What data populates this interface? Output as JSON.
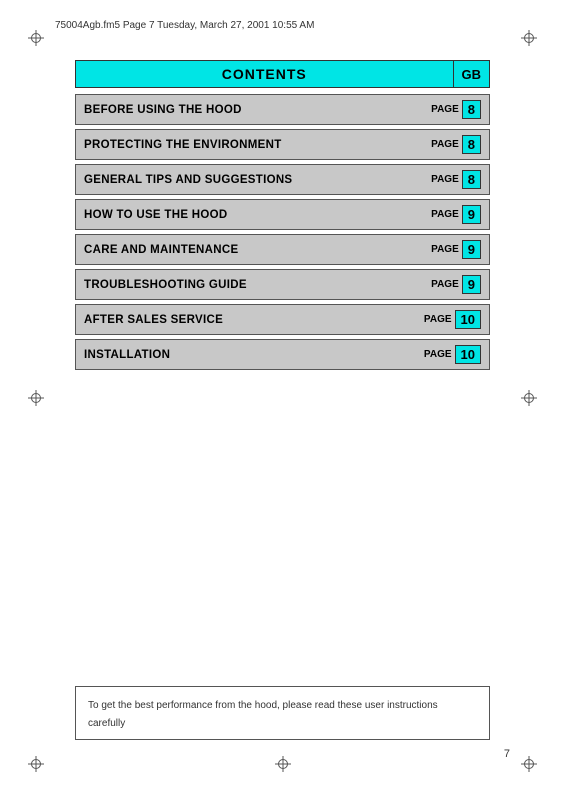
{
  "header": {
    "filename": "75004Agb.fm5  Page 7  Tuesday, March 27, 2001  10:55 AM"
  },
  "contents": {
    "title": "CONTENTS",
    "gb_label": "GB"
  },
  "toc": {
    "rows": [
      {
        "title": "BEFORE USING THE HOOD",
        "page_label": "PAGE",
        "page_num": "8"
      },
      {
        "title": "PROTECTING THE ENVIRONMENT",
        "page_label": "PAGE",
        "page_num": "8"
      },
      {
        "title": "GENERAL TIPS AND SUGGESTIONS",
        "page_label": "PAGE",
        "page_num": "8"
      },
      {
        "title": "HOW TO USE THE HOOD",
        "page_label": "PAGE",
        "page_num": "9"
      },
      {
        "title": "CARE AND MAINTENANCE",
        "page_label": "PAGE",
        "page_num": "9"
      },
      {
        "title": "TROUBLESHOOTING GUIDE",
        "page_label": "PAGE",
        "page_num": "9"
      },
      {
        "title": "AFTER SALES SERVICE",
        "page_label": "PAGE",
        "page_num": "10"
      },
      {
        "title": "INSTALLATION",
        "page_label": "PAGE",
        "page_num": "10"
      }
    ]
  },
  "bottom_note": {
    "text": "To get the best performance from the hood, please read these user instructions carefully"
  },
  "page_number": "7"
}
